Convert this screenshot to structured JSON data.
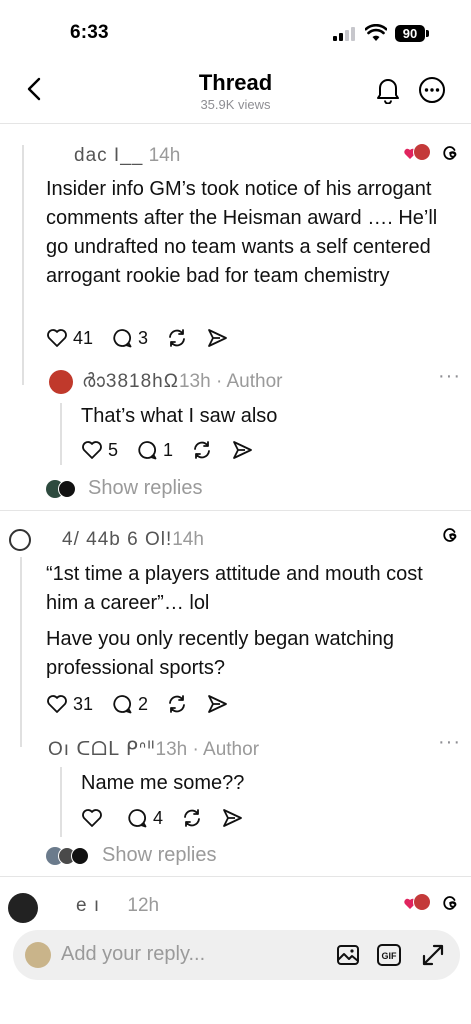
{
  "status_bar": {
    "time": "6:33",
    "battery": "90"
  },
  "header": {
    "title": "Thread",
    "views": "35.9K views"
  },
  "comments": [
    {
      "username": "dac I__",
      "time": "14h",
      "text": "Insider info GM’s took notice of his arrogant comments after the Heisman award …. He’ll go undrafted  no team wants a self centered arrogant rookie bad for team chemistry",
      "likes": "41",
      "replies": "3",
      "reply": {
        "username": "ർാ3818hΩ",
        "time": "13h",
        "author_label": "· Author",
        "text": "That’s what I saw also",
        "likes": "5",
        "replies": "1"
      },
      "show_replies": "Show replies"
    },
    {
      "username": "4/ 44b 6 Ol!",
      "time": "14h",
      "text_1": "“1st time a players attitude and mouth cost him a career”… lol",
      "text_2": "Have you only recently began watching professional sports?",
      "likes": "31",
      "replies": "2",
      "reply": {
        "username": "Oı ᑕᗝᒪ  ᑭᐢᐦ",
        "time": "13h",
        "author_label": "· Author",
        "text": "Name me some??",
        "likes": "",
        "replies": "4"
      },
      "show_replies": "Show replies"
    },
    {
      "username": "e  ı",
      "time": "12h"
    }
  ],
  "reply_bar": {
    "placeholder": "Add your reply..."
  },
  "colors": {
    "accent_red": "#e0245e",
    "muted": "#9a9a9a",
    "divider": "#e5e5e5"
  }
}
